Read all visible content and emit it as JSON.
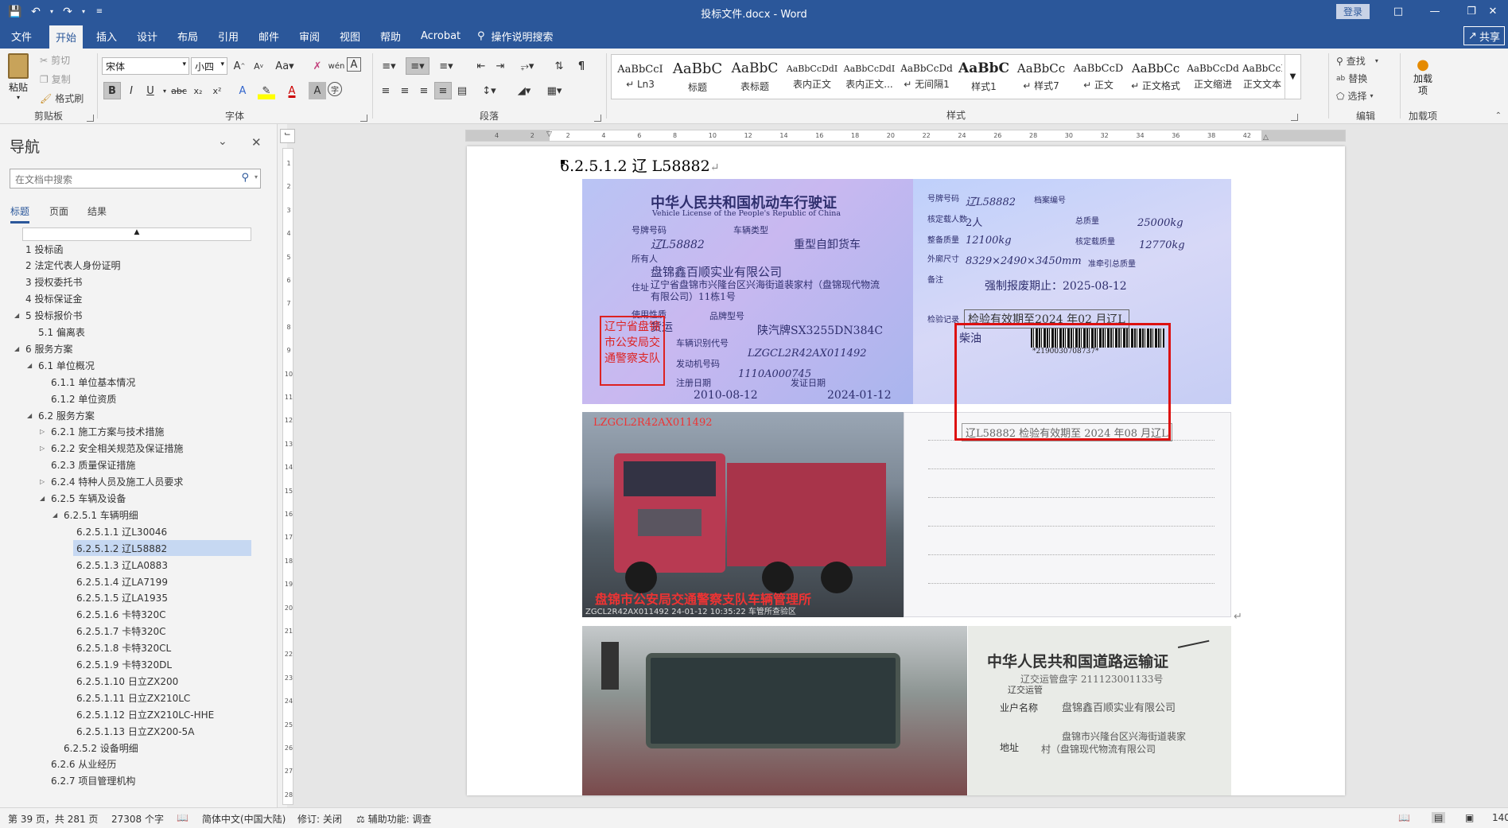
{
  "window": {
    "title": "投标文件.docx - Word",
    "login": "登录"
  },
  "ribbon_tabs": [
    "文件",
    "开始",
    "插入",
    "设计",
    "布局",
    "引用",
    "邮件",
    "审阅",
    "视图",
    "帮助",
    "Acrobat"
  ],
  "tell_me": "操作说明搜索",
  "share": "共享",
  "clipboard": {
    "paste": "粘贴",
    "cut": "剪切",
    "copy": "复制",
    "format_painter": "格式刷",
    "label": "剪贴板"
  },
  "font": {
    "name": "宋体",
    "size": "小四",
    "label": "字体"
  },
  "paragraph": {
    "label": "段落"
  },
  "styles": {
    "label": "样式",
    "items": [
      {
        "preview": "AaBbCcI",
        "name": "↵ Ln3"
      },
      {
        "preview": "AaBbC",
        "name": "标题"
      },
      {
        "preview": "AaBbC",
        "name": "表标题"
      },
      {
        "preview": "AaBbCcDdI",
        "name": "表内正文"
      },
      {
        "preview": "AaBbCcDdI",
        "name": "表内正文..."
      },
      {
        "preview": "AaBbCcDd",
        "name": "↵ 无间隔1"
      },
      {
        "preview": "AaBbC",
        "name": "样式1"
      },
      {
        "preview": "AaBbCc",
        "name": "↵ 样式7"
      },
      {
        "preview": "AaBbCcD",
        "name": "↵ 正文"
      },
      {
        "preview": "AaBbCc",
        "name": "↵ 正文格式"
      },
      {
        "preview": "AaBbCcDd",
        "name": "正文缩进"
      },
      {
        "preview": "AaBbCcDd",
        "name": "正文文本"
      }
    ]
  },
  "editing": {
    "find": "查找",
    "replace": "替换",
    "select": "选择",
    "label": "编辑"
  },
  "addins": {
    "button": "加载项",
    "label": "加载项"
  },
  "nav": {
    "title": "导航",
    "search_placeholder": "在文档中搜索",
    "tabs": [
      "标题",
      "页面",
      "结果"
    ],
    "items": [
      {
        "text": "1 投标函",
        "level": 0,
        "expand": "none"
      },
      {
        "text": "2 法定代表人身份证明",
        "level": 0,
        "expand": "none"
      },
      {
        "text": "3 授权委托书",
        "level": 0,
        "expand": "none"
      },
      {
        "text": "4 投标保证金",
        "level": 0,
        "expand": "none"
      },
      {
        "text": "5 投标报价书",
        "level": 0,
        "expand": "open"
      },
      {
        "text": "5.1 偏离表",
        "level": 1,
        "expand": "none"
      },
      {
        "text": "6 服务方案",
        "level": 0,
        "expand": "open"
      },
      {
        "text": "6.1 单位概况",
        "level": 1,
        "expand": "open"
      },
      {
        "text": "6.1.1 单位基本情况",
        "level": 2,
        "expand": "none"
      },
      {
        "text": "6.1.2 单位资质",
        "level": 2,
        "expand": "none"
      },
      {
        "text": "6.2 服务方案",
        "level": 1,
        "expand": "open"
      },
      {
        "text": "6.2.1 施工方案与技术措施",
        "level": 2,
        "expand": "closed"
      },
      {
        "text": "6.2.2 安全相关规范及保证措施",
        "level": 2,
        "expand": "closed"
      },
      {
        "text": "6.2.3 质量保证措施",
        "level": 2,
        "expand": "none"
      },
      {
        "text": "6.2.4 特种人员及施工人员要求",
        "level": 2,
        "expand": "closed"
      },
      {
        "text": "6.2.5 车辆及设备",
        "level": 2,
        "expand": "open"
      },
      {
        "text": "6.2.5.1 车辆明细",
        "level": 3,
        "expand": "open"
      },
      {
        "text": "6.2.5.1.1 辽L30046",
        "level": 4,
        "expand": "none"
      },
      {
        "text": "6.2.5.1.2 辽L58882",
        "level": 4,
        "expand": "none",
        "selected": true
      },
      {
        "text": "6.2.5.1.3 辽LA0883",
        "level": 4,
        "expand": "none"
      },
      {
        "text": "6.2.5.1.4 辽LA7199",
        "level": 4,
        "expand": "none"
      },
      {
        "text": "6.2.5.1.5 辽LA1935",
        "level": 4,
        "expand": "none"
      },
      {
        "text": "6.2.5.1.6 卡特320C",
        "level": 4,
        "expand": "none"
      },
      {
        "text": "6.2.5.1.7 卡特320C",
        "level": 4,
        "expand": "none"
      },
      {
        "text": "6.2.5.1.8 卡特320CL",
        "level": 4,
        "expand": "none"
      },
      {
        "text": "6.2.5.1.9 卡特320DL",
        "level": 4,
        "expand": "none"
      },
      {
        "text": "6.2.5.1.10 日立ZX200",
        "level": 4,
        "expand": "none"
      },
      {
        "text": "6.2.5.1.11 日立ZX210LC",
        "level": 4,
        "expand": "none"
      },
      {
        "text": "6.2.5.1.12 日立ZX210LC-HHE",
        "level": 4,
        "expand": "none"
      },
      {
        "text": "6.2.5.1.13 日立ZX200-5A",
        "level": 4,
        "expand": "none"
      },
      {
        "text": "6.2.5.2 设备明细",
        "level": 3,
        "expand": "none"
      },
      {
        "text": "6.2.6 从业经历",
        "level": 2,
        "expand": "none"
      },
      {
        "text": "6.2.7 项目管理机构",
        "level": 2,
        "expand": "none"
      }
    ]
  },
  "ruler": {
    "h_ticks": [
      "4",
      "2",
      "2",
      "4",
      "6",
      "8",
      "10",
      "12",
      "14",
      "16",
      "18",
      "20",
      "22",
      "24",
      "26",
      "28",
      "30",
      "32",
      "34",
      "36",
      "38",
      "42"
    ],
    "v_ticks": [
      "1",
      "2",
      "3",
      "4",
      "5",
      "6",
      "7",
      "8",
      "9",
      "10",
      "11",
      "12",
      "13",
      "14",
      "15",
      "16",
      "17",
      "18",
      "19",
      "20",
      "21",
      "22",
      "23",
      "24",
      "25",
      "26",
      "27",
      "28"
    ]
  },
  "document": {
    "heading": "6.2.5.1.2  辽 L58882",
    "license_left": {
      "title_cn": "中华人民共和国机动车行驶证",
      "title_en": "Vehicle License of the People's Republic of China",
      "plate_label": "号牌号码",
      "plate": "辽L58882",
      "vtype_label": "车辆类型",
      "vtype": "重型自卸货车",
      "owner_label": "所有人",
      "owner": "盘锦鑫百顺实业有限公司",
      "addr_label": "住址",
      "addr": "辽宁省盘锦市兴隆台区兴海街道裴家村（盘锦现代物流有限公司）11栋1号",
      "use_label": "使用性质",
      "use": "货运",
      "model_label": "品牌型号",
      "model": "陕汽牌SX3255DN384C",
      "vin_label": "车辆识别代号",
      "vin": "LZGCL2R42AX011492",
      "engine_label": "发动机号码",
      "engine": "1110A000745",
      "reg_label": "注册日期",
      "reg": "2010-08-12",
      "issue_label": "发证日期",
      "issue": "2024-01-12",
      "stamp": "辽宁省盘锦市公安局交通警察支队"
    },
    "license_right": {
      "plate_label": "号牌号码",
      "plate": "辽L58882",
      "file_label": "档案编号",
      "seats_label": "核定载人数",
      "seats": "2人",
      "total_label": "总质量",
      "total": "25000kg",
      "curb_label": "整备质量",
      "curb": "12100kg",
      "load_label": "核定载质量",
      "load": "12770kg",
      "dims_label": "外廓尺寸",
      "dims": "8329×2490×3450mm",
      "tow_label": "准牵引总质量",
      "remark_label": "备注",
      "remark": "强制报废期止：2025-08-12",
      "inspect_label": "检验记录",
      "inspect1": "检验有效期至2024 年02 月辽L",
      "fuel": "柴油",
      "barcode": "*2190030708737*",
      "inspect2": "辽L58882 检验有效期至 2024 年08 月辽L"
    },
    "truck_photo": {
      "vin_overlay": "LZGCL2R42AX011492",
      "caption": "盘锦市公安局交通警察支队车辆管理所",
      "footer": "ZGCL2R42AX011492 24-01-12 10:35:22 车管所查验区"
    },
    "road_cert": {
      "title": "中华人民共和国道路运输证",
      "number": "辽交运管盘字 211123001133号",
      "number_prefix": "辽交运管",
      "owner_label": "业户名称",
      "owner": "盘锦鑫百顺实业有限公司",
      "addr_label": "地址",
      "addr1": "盘锦市兴隆台区兴海街道裴家",
      "addr2": "村（盘锦现代物流有限公司"
    }
  },
  "status": {
    "page": "第 39 页，共 281 页",
    "words": "27308 个字",
    "lang": "简体中文(中国大陆)",
    "track": "修订: 关闭",
    "access": "辅助功能: 调查",
    "zoom": "140"
  },
  "colors": {
    "brand": "#2b579a",
    "highlight_box": "#dd1111"
  }
}
